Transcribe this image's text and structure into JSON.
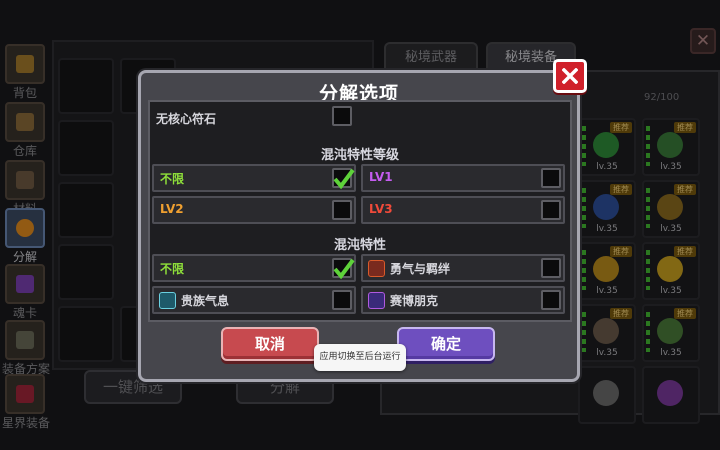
{
  "sidebar": {
    "items": [
      {
        "label": "背包",
        "icon": "backpack-icon",
        "color": "#a37a2c"
      },
      {
        "label": "仓库",
        "icon": "warehouse-icon",
        "color": "#8a6a3a"
      },
      {
        "label": "材料",
        "icon": "materials-icon",
        "color": "#6f5a43"
      },
      {
        "label": "分解",
        "icon": "disassemble-icon",
        "color": "#e08a1e"
      },
      {
        "label": "魂卡",
        "icon": "soul-card-icon",
        "color": "#7a3fb0"
      },
      {
        "label": "装备方案",
        "icon": "equipment-plan-icon",
        "color": "#6b6b58"
      },
      {
        "label": "星界装备",
        "icon": "astral-equipment-icon",
        "color": "#a0253a"
      }
    ]
  },
  "background": {
    "one_key_filter_label": "一键筛选",
    "disassemble_label": "分解",
    "tabs": [
      {
        "label": "秘境武器"
      },
      {
        "label": "秘境装备"
      }
    ],
    "count": "92/100",
    "close_label": "✕",
    "card_tag": "推荐",
    "card_level": "lv.35"
  },
  "dialog": {
    "title": "分解选项",
    "top_item": {
      "label": "无核心符石",
      "checked": false
    },
    "level_section": {
      "title": "混沌特性等级",
      "options": [
        {
          "label": "不限",
          "color": "#8fe03a",
          "checked": true
        },
        {
          "label": "LV1",
          "color": "#c45cf0",
          "checked": false
        },
        {
          "label": "LV2",
          "color": "#f0a030",
          "checked": false
        },
        {
          "label": "LV3",
          "color": "#f04a3a",
          "checked": false
        }
      ]
    },
    "trait_section": {
      "title": "混沌特性",
      "options": [
        {
          "label": "不限",
          "color": "#8fe03a",
          "checked": true,
          "icon": ""
        },
        {
          "label": "勇气与羁绊",
          "color": "#d6d6dc",
          "checked": false,
          "icon": "courage-bond-icon"
        },
        {
          "label": "贵族气息",
          "color": "#d6d6dc",
          "checked": false,
          "icon": "noble-aura-icon"
        },
        {
          "label": "赛博朋克",
          "color": "#d6d6dc",
          "checked": false,
          "icon": "cyberpunk-icon"
        }
      ]
    },
    "cancel_label": "取消",
    "confirm_label": "确定",
    "check_color": "#5ed23a",
    "close_color": "#d0202a"
  },
  "toast": {
    "text": "应用切换至后台运行"
  }
}
